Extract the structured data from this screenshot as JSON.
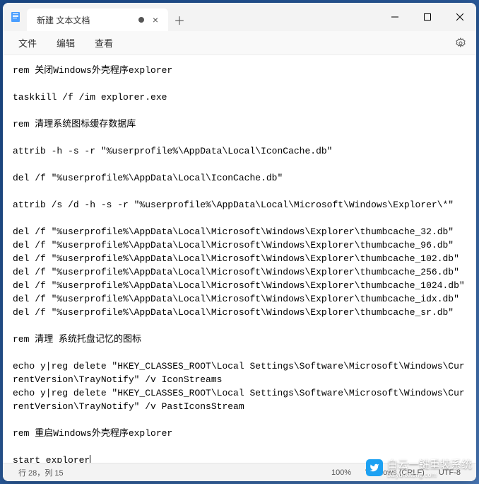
{
  "window": {
    "tab_title": "新建 文本文档",
    "tab_dirty": true
  },
  "menubar": {
    "file": "文件",
    "edit": "编辑",
    "view": "查看"
  },
  "editor": {
    "content": "rem 关闭Windows外壳程序explorer\n\ntaskkill /f /im explorer.exe\n\nrem 清理系统图标缓存数据库\n\nattrib -h -s -r \"%userprofile%\\AppData\\Local\\IconCache.db\"\n\ndel /f \"%userprofile%\\AppData\\Local\\IconCache.db\"\n\nattrib /s /d -h -s -r \"%userprofile%\\AppData\\Local\\Microsoft\\Windows\\Explorer\\*\"\n\ndel /f \"%userprofile%\\AppData\\Local\\Microsoft\\Windows\\Explorer\\thumbcache_32.db\"\ndel /f \"%userprofile%\\AppData\\Local\\Microsoft\\Windows\\Explorer\\thumbcache_96.db\"\ndel /f \"%userprofile%\\AppData\\Local\\Microsoft\\Windows\\Explorer\\thumbcache_102.db\"\ndel /f \"%userprofile%\\AppData\\Local\\Microsoft\\Windows\\Explorer\\thumbcache_256.db\"\ndel /f \"%userprofile%\\AppData\\Local\\Microsoft\\Windows\\Explorer\\thumbcache_1024.db\"\ndel /f \"%userprofile%\\AppData\\Local\\Microsoft\\Windows\\Explorer\\thumbcache_idx.db\"\ndel /f \"%userprofile%\\AppData\\Local\\Microsoft\\Windows\\Explorer\\thumbcache_sr.db\"\n\nrem 清理 系统托盘记忆的图标\n\necho y|reg delete \"HKEY_CLASSES_ROOT\\Local Settings\\Software\\Microsoft\\Windows\\CurrentVersion\\TrayNotify\" /v IconStreams\necho y|reg delete \"HKEY_CLASSES_ROOT\\Local Settings\\Software\\Microsoft\\Windows\\CurrentVersion\\TrayNotify\" /v PastIconsStream\n\nrem 重启Windows外壳程序explorer\n\nstart explorer"
  },
  "statusbar": {
    "position": "行 28，列 15",
    "zoom": "100%",
    "encoding": "Windows (CRLF)",
    "format": "UTF-8"
  },
  "watermark": {
    "text": "白云一键重装系统",
    "sub": "baiyunxitong.com"
  }
}
